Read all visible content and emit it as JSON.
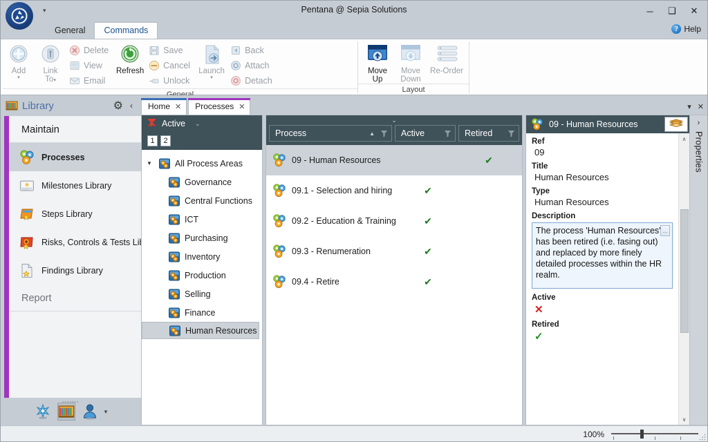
{
  "window": {
    "title": "Pentana @ Sepia Solutions",
    "minimize_label": "─",
    "maximize_label": "❑",
    "close_label": "✕",
    "quick_access_caret": "▾",
    "logo_name": "pentana-logo"
  },
  "ribbon": {
    "tabs": [
      {
        "label": "General",
        "active": false
      },
      {
        "label": "Commands",
        "active": true
      }
    ],
    "help": {
      "label": "Help",
      "badge": "?"
    },
    "groups": [
      {
        "name": "General",
        "label": "General",
        "big_buttons": [
          {
            "label": "Add",
            "icon": "add-icon",
            "has_caret": true,
            "enabled": false
          },
          {
            "label": "Link\nTo",
            "label_line1": "Link",
            "label_line2": "To",
            "icon": "link-to-icon",
            "has_caret": true,
            "enabled": false
          },
          {
            "label": "Refresh",
            "icon": "refresh-icon",
            "enabled": true
          },
          {
            "label": "Launch",
            "icon": "launch-icon",
            "has_caret": true,
            "enabled": false
          }
        ],
        "small_buttons": [
          {
            "label": "Delete",
            "icon": "delete-icon",
            "enabled": false
          },
          {
            "label": "View",
            "icon": "view-icon",
            "enabled": false
          },
          {
            "label": "Email",
            "icon": "email-icon",
            "enabled": false
          },
          {
            "label": "Save",
            "icon": "save-icon",
            "enabled": false
          },
          {
            "label": "Cancel",
            "icon": "cancel-icon",
            "enabled": false
          },
          {
            "label": "Unlock",
            "icon": "unlock-icon",
            "enabled": false
          },
          {
            "label": "Back",
            "icon": "back-icon",
            "enabled": false
          },
          {
            "label": "Attach",
            "icon": "attach-icon",
            "enabled": false
          },
          {
            "label": "Detach",
            "icon": "detach-icon",
            "enabled": false
          }
        ]
      },
      {
        "name": "Layout",
        "label": "Layout",
        "big_buttons": [
          {
            "label_line1": "Move",
            "label_line2": "Up",
            "icon": "move-up-icon",
            "enabled": true
          },
          {
            "label_line1": "Move",
            "label_line2": "Down",
            "icon": "move-down-icon",
            "enabled": false
          },
          {
            "label_line1": "Re-Order",
            "label_line2": "",
            "icon": "re-order-icon",
            "enabled": false
          }
        ]
      }
    ]
  },
  "sidebar": {
    "header": {
      "title": "Library",
      "icon": "library-icon",
      "gear": "⚙",
      "collapse": "‹"
    },
    "section_maintain": "Maintain",
    "section_report": "Report",
    "report_chevron": "⌄",
    "items": [
      {
        "label": "Processes",
        "icon": "processes-icon",
        "selected": true
      },
      {
        "label": "Milestones Library",
        "icon": "milestones-icon",
        "selected": false
      },
      {
        "label": "Steps Library",
        "icon": "steps-icon",
        "selected": false
      },
      {
        "label": "Risks, Controls & Tests Libra",
        "icon": "risks-icon",
        "selected": false
      },
      {
        "label": "Findings Library",
        "icon": "findings-icon",
        "selected": false
      }
    ],
    "footer_icons": [
      {
        "name": "explorer-icon",
        "selected": false
      },
      {
        "name": "library-icon",
        "selected": true
      },
      {
        "name": "user-icon",
        "selected": false
      }
    ],
    "footer_caret": "▾"
  },
  "doctabs": {
    "tabs": [
      {
        "label": "Home",
        "close": "✕",
        "accent": "#3b6fb5",
        "active": false
      },
      {
        "label": "Processes",
        "close": "✕",
        "accent": "#a035bf",
        "active": true
      }
    ],
    "dropdown": "▾",
    "close_all": "✕"
  },
  "tree_pane": {
    "filter": {
      "label": "Active",
      "x_icon": "filter-clear-icon",
      "chevron": "⌄"
    },
    "pages": [
      "1",
      "2"
    ],
    "root": {
      "label": "All Process Areas",
      "icon": "process-area-icon",
      "expander": "▼"
    },
    "nodes": [
      {
        "label": "Governance",
        "icon": "process-area-icon",
        "selected": false
      },
      {
        "label": "Central Functions",
        "icon": "process-area-icon",
        "selected": false
      },
      {
        "label": "ICT",
        "icon": "process-area-icon",
        "selected": false
      },
      {
        "label": "Purchasing",
        "icon": "process-area-icon",
        "selected": false
      },
      {
        "label": "Inventory",
        "icon": "process-area-icon",
        "selected": false
      },
      {
        "label": "Production",
        "icon": "process-area-icon",
        "selected": false
      },
      {
        "label": "Selling",
        "icon": "process-area-icon",
        "selected": false
      },
      {
        "label": "Finance",
        "icon": "process-area-icon",
        "selected": false
      },
      {
        "label": "Human Resources",
        "icon": "process-area-icon",
        "selected": true
      }
    ]
  },
  "list_pane": {
    "collapse_chevron": "⌄",
    "columns": [
      {
        "label": "Process",
        "sort": "▲",
        "filter_icon": "funnel-icon"
      },
      {
        "label": "Active",
        "sort": "",
        "filter_icon": "funnel-icon"
      },
      {
        "label": "Retired",
        "sort": "",
        "filter_icon": "funnel-icon"
      }
    ],
    "rows": [
      {
        "name": "09 - Human Resources",
        "icon": "process-icon",
        "active": "",
        "retired": "✔",
        "selected": true
      },
      {
        "name": "09.1 - Selection and hiring",
        "icon": "process-icon",
        "active": "✔",
        "retired": "",
        "selected": false
      },
      {
        "name": "09.2 - Education & Training",
        "icon": "process-icon",
        "active": "✔",
        "retired": "",
        "selected": false
      },
      {
        "name": "09.3 - Renumeration",
        "icon": "process-icon",
        "active": "✔",
        "retired": "",
        "selected": false
      },
      {
        "name": "09.4 - Retire",
        "icon": "process-icon",
        "active": "✔",
        "retired": "",
        "selected": false
      }
    ]
  },
  "properties": {
    "header_title": "09 - Human Resources",
    "header_icon": "process-icon",
    "header_button_icon": "open-book-icon",
    "tab_label": "Properties",
    "tab_chevron": "›",
    "fields": {
      "ref_label": "Ref",
      "ref_value": "09",
      "title_label": "Title",
      "title_value": "Human Resources",
      "type_label": "Type",
      "type_value": "Human Resources",
      "description_label": "Description",
      "description_value": "The process 'Human Resources' has been retired (i.e. fasing out) and replaced by more finely detailed processes within the HR realm.",
      "description_ellipsis": "...",
      "active_label": "Active",
      "active_value": "✕",
      "retired_label": "Retired",
      "retired_value": "✓"
    },
    "scroll_up": "∧",
    "scroll_down": "∨"
  },
  "statusbar": {
    "zoom_percent": "100%"
  },
  "colors": {
    "chrome": "#c5ccd3",
    "dark_panel": "#3f5159",
    "accent_purple": "#a035bf",
    "accent_blue": "#3b6fb5",
    "selection": "#ccd2d8",
    "check_green": "#1f7a1f",
    "cross_red": "#d62020",
    "link_blue": "#1b5390"
  }
}
